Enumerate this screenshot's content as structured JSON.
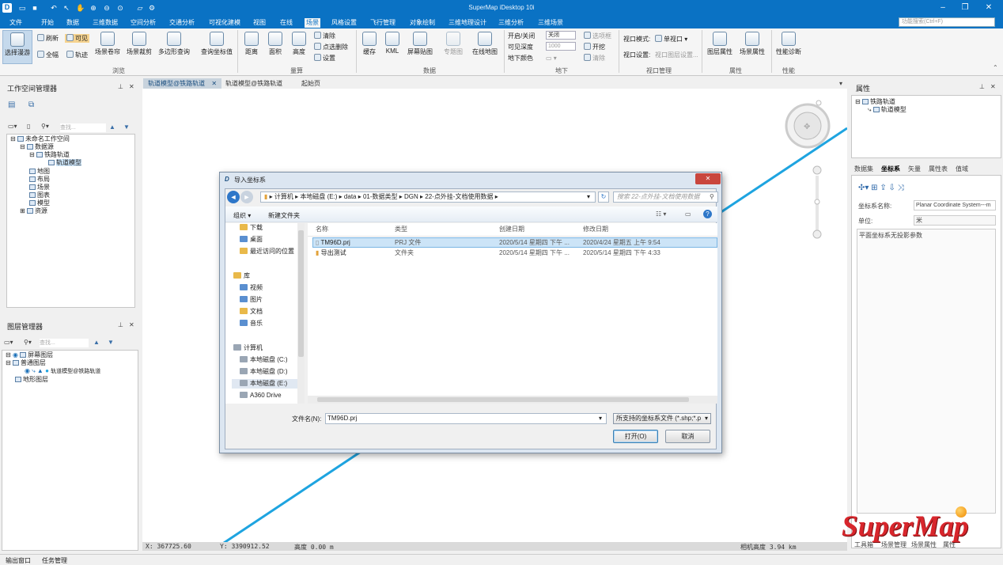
{
  "app": {
    "title": "SuperMap iDesktop 10i"
  },
  "menu": [
    "文件",
    "开始",
    "数据",
    "三维数据",
    "空间分析",
    "交通分析",
    "可视化建模",
    "视图",
    "在线",
    "场景",
    "风格设置",
    "飞行管理",
    "对象绘制",
    "三维地理设计",
    "三维分析",
    "三维场景"
  ],
  "active_menu": "场景",
  "search_placeholder": "功能搜索(Ctrl+F)",
  "ribbon": {
    "browse": {
      "select_browse": "选择漫游",
      "refresh": "刷新",
      "visible": "可见",
      "full": "全幅",
      "track": "轨迹",
      "scene_roll": "场景卷帘",
      "scene_crop": "场景裁剪",
      "polygon_query": "多边形查询",
      "query_coord": "查询坐标值",
      "group": "浏览"
    },
    "measure": {
      "distance": "距离",
      "area": "面积",
      "height": "高度",
      "clear": "清除",
      "point_delete": "点选删除",
      "settings": "设置",
      "group": "量算"
    },
    "data": {
      "cache": "缓存",
      "kml": "KML",
      "screen_tile": "屏幕贴图",
      "special": "专题图",
      "online_map": "在线地图",
      "group": "数据"
    },
    "underground": {
      "open_close": "开启/关闭",
      "visible_depth": "可见深度",
      "ground_color": "地下颜色",
      "opacity_value": "关闭",
      "depth_value": "1000",
      "clip_box": "选项框",
      "dig": "开挖",
      "clear": "清除",
      "group": "地下"
    },
    "viewport": {
      "mode_label": "视口模式:",
      "mode_value": "单视口",
      "settings_label": "视口设置:",
      "settings_value": "视口图层设置...",
      "group": "视口管理"
    },
    "props": {
      "layer_props": "图层属性",
      "scene_props": "场景属性",
      "group": "属性"
    },
    "perf": {
      "diagnose": "性能诊断",
      "group": "性能"
    }
  },
  "workspace": {
    "title": "工作空间管理器",
    "search_placeholder": "查找...",
    "tree": [
      "未命名工作空间",
      "数据源",
      "铁路轨道",
      "轨道模型",
      "地图",
      "布局",
      "场景",
      "图表",
      "模型",
      "资源"
    ]
  },
  "layers": {
    "title": "图层管理器",
    "search_placeholder": "查找...",
    "tree": [
      "屏幕图层",
      "普通图层",
      "轨道模型@铁路轨道",
      "地形图层"
    ]
  },
  "tabs": [
    "轨道模型@铁路轨道",
    "轨道模型@铁路轨道",
    "起始页"
  ],
  "dialog": {
    "title": "导入坐标系",
    "breadcrumb": [
      "计算机",
      "本地磁盘 (E:)",
      "data",
      "01-数据类型",
      "DGN",
      "22-点外挂-文档使用数据"
    ],
    "search_placeholder": "搜索 22-点外挂-文档使用数据",
    "organize": "组织 ▾",
    "new_folder": "新建文件夹",
    "nav": {
      "favorites": [
        "下载",
        "桌面",
        "最近访问的位置"
      ],
      "library": "库",
      "libraries": [
        "视频",
        "图片",
        "文档",
        "音乐"
      ],
      "computer": "计算机",
      "drives": [
        "本地磁盘 (C:)",
        "本地磁盘 (D:)",
        "本地磁盘 (E:)",
        "A360 Drive"
      ]
    },
    "columns": [
      "名称",
      "类型",
      "创建日期",
      "修改日期"
    ],
    "files": [
      {
        "name": "TM96D.prj",
        "type": "PRJ 文件",
        "created": "2020/5/14 星期四 下午 ...",
        "modified": "2020/4/24 星期五 上午 9:54"
      },
      {
        "name": "导出测试",
        "type": "文件夹",
        "created": "2020/5/14 星期四 下午 ...",
        "modified": "2020/5/14 星期四 下午 4:33"
      }
    ],
    "filename_label": "文件名(N):",
    "filename_value": "TM96D.prj",
    "filter": "所支持的坐标系文件 (*.shp;*.p",
    "open": "打开(O)",
    "cancel": "取消"
  },
  "properties": {
    "title": "属性",
    "tree": [
      "铁路轨道",
      "轨道模型"
    ],
    "tabs": [
      "数据集",
      "坐标系",
      "矢量",
      "属性表",
      "值域"
    ],
    "coord_name_label": "坐标系名称:",
    "coord_name_value": "Planar Coordinate System---m",
    "unit_label": "单位:",
    "unit_value": "米",
    "info": "平面坐标系无投影参数",
    "bottom_tabs": [
      "工具箱",
      "场景管理",
      "场景属性",
      "属性"
    ]
  },
  "statusbar": {
    "x": "X: 367725.60",
    "y": "Y: 3390912.52",
    "height": "高度 0.00 m",
    "camera": "相机高度 3.94 km"
  },
  "bottom": {
    "output": "输出窗口",
    "tasks": "任务管理"
  },
  "logo": "SuperMap",
  "colors": {
    "brand": "#0a72c4",
    "track_line": "#1ea4e0",
    "logo_red": "#d8262c"
  }
}
